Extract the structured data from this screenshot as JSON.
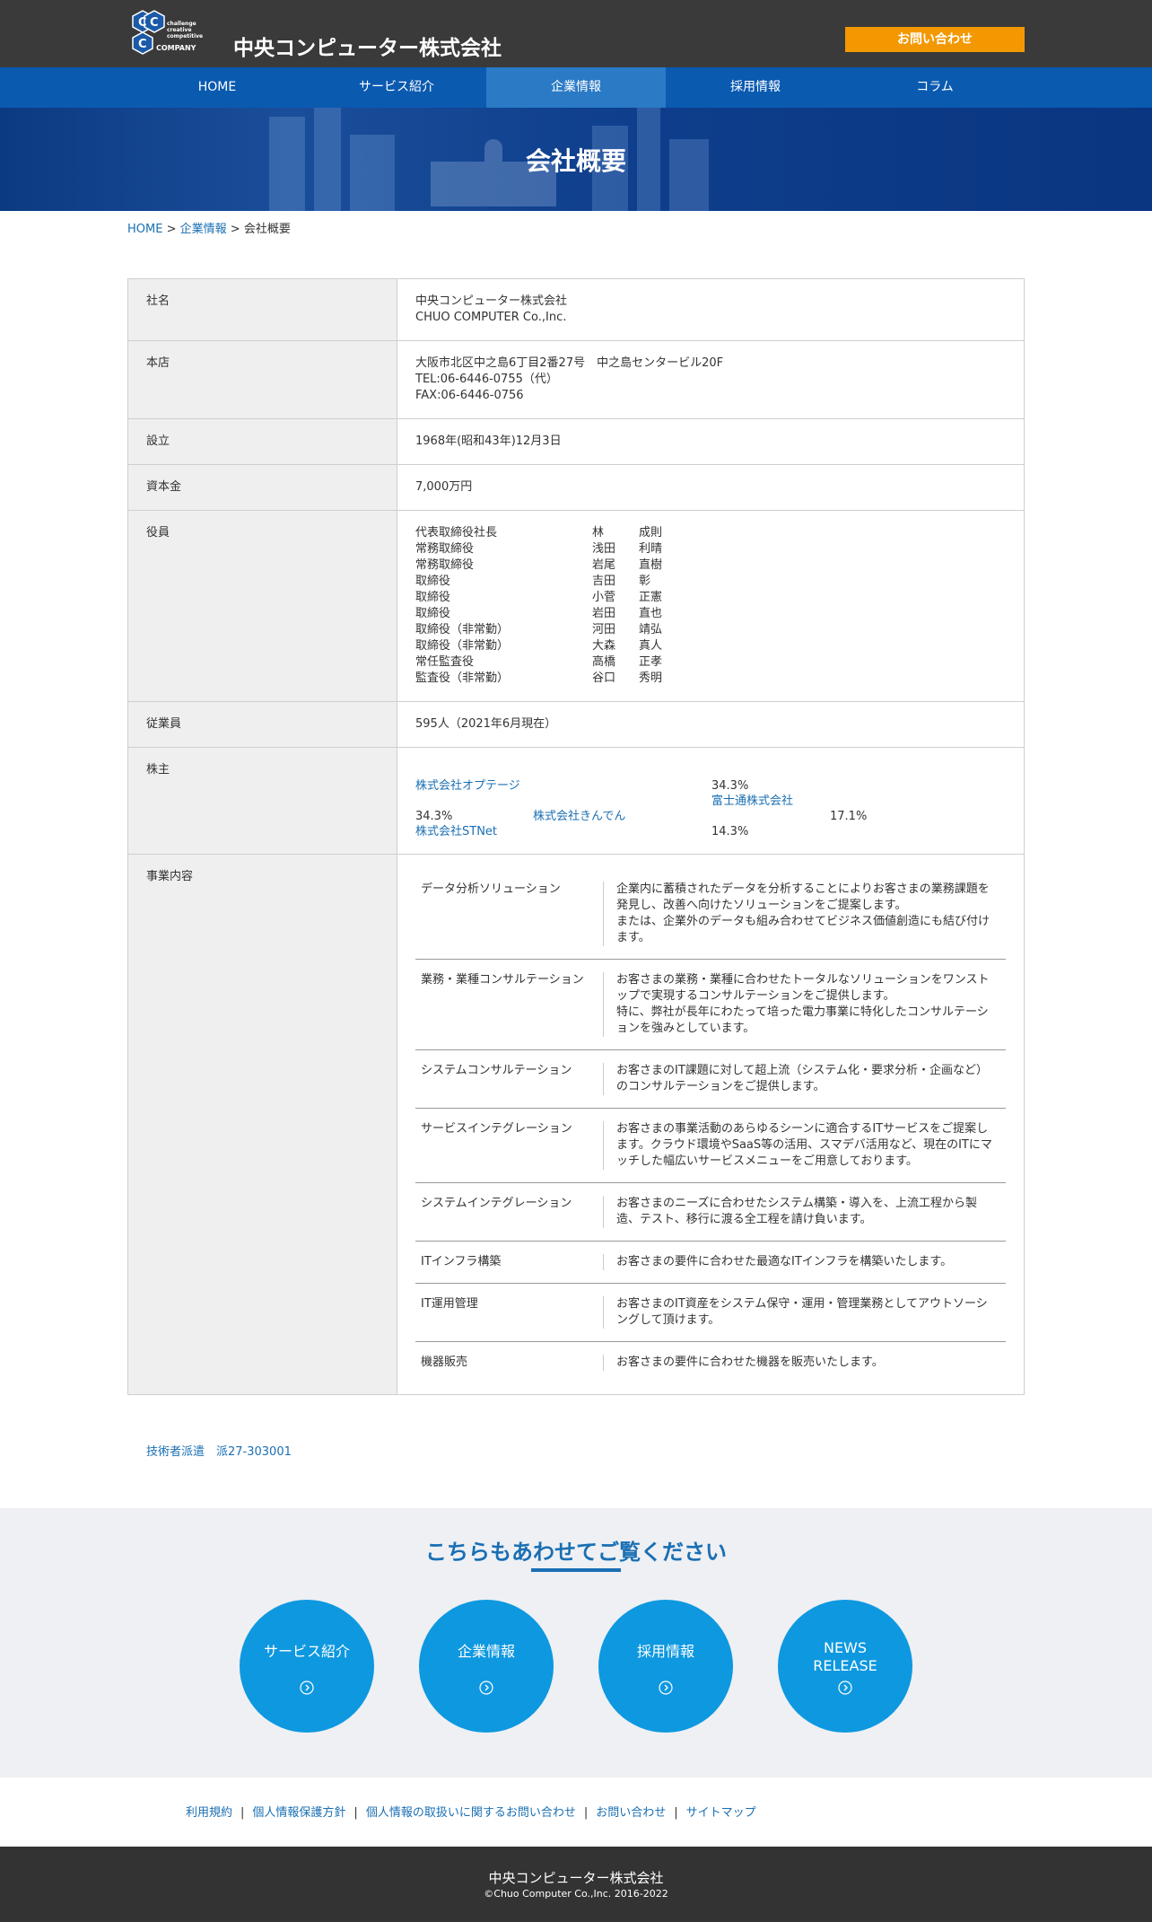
{
  "header": {
    "logo_lines": [
      "challenge",
      "creative",
      "competitive",
      "COMPANY"
    ],
    "company_name": "中央コンピューター株式会社",
    "contact_button": "お問い合わせ",
    "brand_color": "#3a3a3a",
    "contact_color": "#f39800"
  },
  "nav": {
    "items": [
      "HOME",
      "サービス紹介",
      "企業情報",
      "採用情報",
      "コラム"
    ],
    "active": "企業情報",
    "color": "#0a5ab0"
  },
  "banner": {
    "title": "会社概要"
  },
  "breadcrumb": {
    "home": "HOME",
    "sep1": " > ",
    "parent": "企業情報",
    "sep2": " > ",
    "current": "会社概要"
  },
  "profile": {
    "company": {
      "label": "社名",
      "name_ja": "中央コンピューター株式会社",
      "name_en": "CHUO COMPUTER Co.,Inc."
    },
    "address": {
      "label": "本店",
      "address": "大阪市北区中之島6丁目2番27号　中之島センタービル20F",
      "tel": "TEL:06-6446-0755（代）",
      "fax": "FAX:06-6446-0756"
    },
    "established": {
      "label": "設立",
      "value": "1968年(昭和43年)12月3日"
    },
    "capital": {
      "label": "資本金",
      "value": "7,000万円"
    },
    "officers": {
      "label": "役員",
      "list": [
        {
          "role": "代表取締役社長",
          "name": "林　　　成則"
        },
        {
          "role": "常務取締役",
          "name": "浅田　　利晴"
        },
        {
          "role": "常務取締役",
          "name": "岩尾　　直樹"
        },
        {
          "role": "取締役",
          "name": "吉田　　彰"
        },
        {
          "role": "取締役",
          "name": "小菅　　正憲"
        },
        {
          "role": "取締役",
          "name": "岩田　　直也"
        },
        {
          "role": "取締役（非常勤）",
          "name": "河田　　靖弘"
        },
        {
          "role": "取締役（非常勤）",
          "name": "大森　　真人"
        },
        {
          "role": "常任監査役",
          "name": "高橋　　正孝"
        },
        {
          "role": "監査役（非常勤）",
          "name": "谷口　　秀明"
        }
      ]
    },
    "employees": {
      "label": "従業員",
      "value": "595人（2021年6月現在）"
    },
    "shareholders": {
      "label": "株主",
      "list": [
        {
          "name": "株式会社オプテージ",
          "pct": "34.3%"
        },
        {
          "name": "富士通株式会社",
          "pct": "34.3%"
        },
        {
          "name": "株式会社きんでん",
          "pct": "17.1%"
        },
        {
          "name": "株式会社STNet",
          "pct": "14.3%"
        }
      ]
    },
    "business": {
      "label": "事業内容",
      "list": [
        {
          "name": "データ分析ソリューション",
          "desc": "企業内に蓄積されたデータを分析することによりお客さまの業務課題を発見し、改善へ向けたソリューションをご提案します。\nまたは、企業外のデータも組み合わせてビジネス価値創造にも結び付けます。"
        },
        {
          "name": "業務・業種コンサルテーション",
          "desc": "お客さまの業務・業種に合わせたトータルなソリューションをワンストップで実現するコンサルテーションをご提供します。\n特に、弊社が長年にわたって培った電力事業に特化したコンサルテーションを強みとしています。"
        },
        {
          "name": "システムコンサルテーション",
          "desc": "お客さまのIT課題に対して超上流（システム化・要求分析・企画など）のコンサルテーションをご提供します。"
        },
        {
          "name": "サービスインテグレーション",
          "desc": "お客さまの事業活動のあらゆるシーンに適合するITサービスをご提案します。クラウド環境やSaaS等の活用、スマデバ活用など、現在のITにマッチした幅広いサービスメニューをご用意しております。"
        },
        {
          "name": "システムインテグレーション",
          "desc": "お客さまのニーズに合わせたシステム構築・導入を、上流工程から製造、テスト、移行に渡る全工程を請け負います。"
        },
        {
          "name": "ITインフラ構築",
          "desc": "お客さまの要件に合わせた最適なITインフラを構築いたします。"
        },
        {
          "name": "IT運用管理",
          "desc": "お客さまのIT資産をシステム保守・運用・管理業務としてアウトソーシングして頂けます。"
        },
        {
          "name": "機器販売",
          "desc": "お客さまの要件に合わせた機器を販売いたします。"
        }
      ]
    }
  },
  "dispatch_license": "技術者派遣　派27-303001",
  "see_also": {
    "title": "こちらもあわせてご覧ください",
    "items": [
      "サービス紹介",
      "企業情報",
      "採用情報",
      "NEWS\nRELEASE"
    ],
    "circle_color": "#0e98e0"
  },
  "footer_links": [
    "利用規約",
    "個人情報保護方針",
    "個人情報の取扱いに関するお問い合わせ",
    "お問い合わせ",
    "サイトマップ"
  ],
  "footer": {
    "company": "中央コンピューター株式会社",
    "copyright": "©Chuo Computer Co.,Inc. 2016-2022"
  }
}
